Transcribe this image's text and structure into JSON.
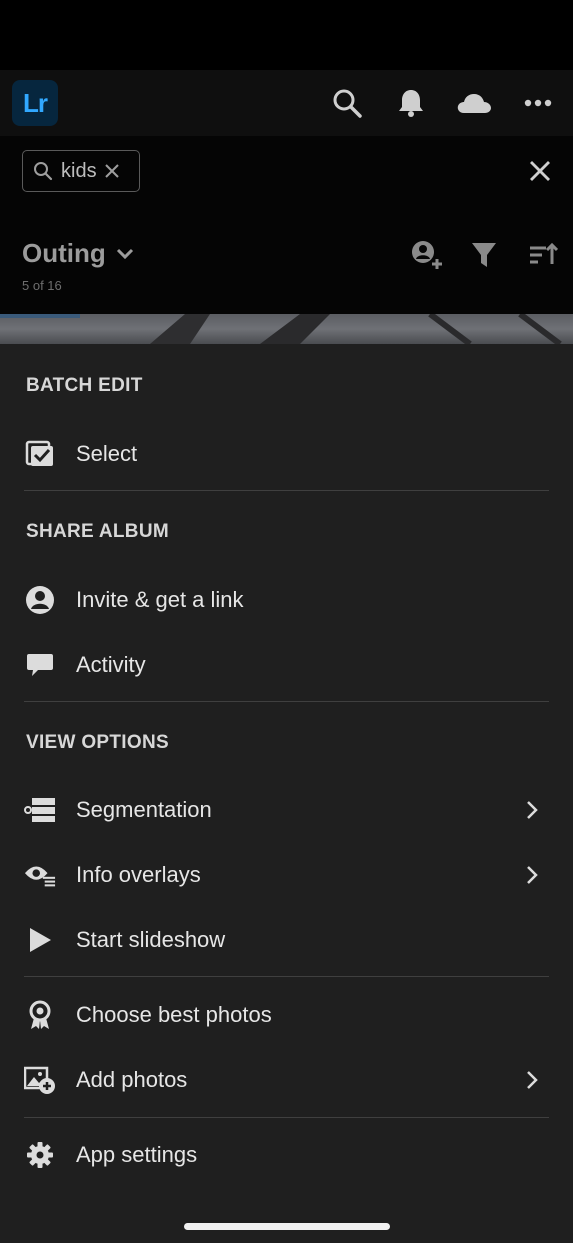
{
  "app": {
    "logo_text": "Lr",
    "accent": "#31a8ff"
  },
  "topbar": {
    "icons": [
      "search-icon",
      "bell-icon",
      "cloud-icon",
      "more-icon"
    ]
  },
  "search": {
    "chip_text": "kids",
    "chip_icons": [
      "search-icon",
      "clear-chip-icon"
    ],
    "close_icon": "close-icon"
  },
  "album": {
    "title": "Outing",
    "count": "5 of 16",
    "icons": [
      "add-person-icon",
      "filter-icon",
      "sort-icon"
    ]
  },
  "menu": {
    "sections": [
      {
        "header": "BATCH EDIT"
      },
      {
        "header": "SHARE ALBUM"
      },
      {
        "header": "VIEW OPTIONS"
      }
    ],
    "items": [
      {
        "label": "Select",
        "icon": "checkbox-multi-icon",
        "has_chevron": false
      },
      {
        "label": "Invite & get a link",
        "icon": "person-icon",
        "has_chevron": false
      },
      {
        "label": "Activity",
        "icon": "comment-icon",
        "has_chevron": false
      },
      {
        "label": "Segmentation",
        "icon": "segmentation-icon",
        "has_chevron": true
      },
      {
        "label": "Info overlays",
        "icon": "eye-list-icon",
        "has_chevron": true
      },
      {
        "label": "Start slideshow",
        "icon": "play-icon",
        "has_chevron": false
      },
      {
        "label": "Choose best photos",
        "icon": "award-icon",
        "has_chevron": false
      },
      {
        "label": "Add photos",
        "icon": "add-photo-icon",
        "has_chevron": true
      },
      {
        "label": "App settings",
        "icon": "gear-icon",
        "has_chevron": false
      }
    ]
  }
}
